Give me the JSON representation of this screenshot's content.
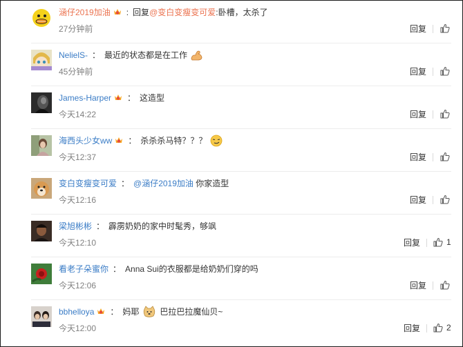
{
  "comments": [
    {
      "user": "涵仔2019加油",
      "user_color": "#eb7350",
      "vip": true,
      "reply_prefix": "回复",
      "mention": "@变白变瘦变可爱",
      "separator": ":",
      "text": "卧槽，太杀了",
      "emoji": "",
      "time": "27分钟前",
      "reply_label": "回复",
      "likes": "",
      "avatar": "duck"
    },
    {
      "user": "NelielS-",
      "user_color": "#3a7cc6",
      "vip": false,
      "reply_prefix": "",
      "mention": "",
      "separator": "：",
      "text": "最近的状态都是在工作",
      "emoji": "muscle-emoji",
      "time": "45分钟前",
      "reply_label": "回复",
      "likes": "",
      "avatar": "anime"
    },
    {
      "user": "James-Harper",
      "user_color": "#3a7cc6",
      "vip": true,
      "reply_prefix": "",
      "mention": "",
      "separator": "：",
      "text": "这造型",
      "emoji": "",
      "time": "今天14:22",
      "reply_label": "回复",
      "likes": "",
      "avatar": "dark"
    },
    {
      "user": "海西头少女ww",
      "user_color": "#3a7cc6",
      "vip": true,
      "reply_prefix": "",
      "mention": "",
      "separator": "：",
      "text": "杀杀杀马特？？？",
      "emoji": "smirk-emoji",
      "time": "今天12:37",
      "reply_label": "回复",
      "likes": "",
      "avatar": "girl"
    },
    {
      "user": "变白变瘦变可爱",
      "user_color": "#3a7cc6",
      "vip": false,
      "reply_prefix": "",
      "mention": "@涵仔2019加油",
      "separator": "：",
      "text": " 你家造型",
      "emoji": "",
      "time": "今天12:16",
      "reply_label": "回复",
      "likes": "",
      "avatar": "dog"
    },
    {
      "user": "梁旭彬彬",
      "user_color": "#3a7cc6",
      "vip": false,
      "reply_prefix": "",
      "mention": "",
      "separator": "：",
      "text": "霹雳奶奶的家中时髦秀，够飒",
      "emoji": "",
      "time": "今天12:10",
      "reply_label": "回复",
      "likes": "1",
      "avatar": "woman"
    },
    {
      "user": "看老子朵蜜你",
      "user_color": "#3a7cc6",
      "vip": false,
      "reply_prefix": "",
      "mention": "",
      "separator": "：",
      "text": "Anna Sui的衣服都是给奶奶们穿的吗",
      "emoji": "",
      "time": "今天12:06",
      "reply_label": "回复",
      "likes": "",
      "avatar": "flower"
    },
    {
      "user": "bbhelloya",
      "user_color": "#3a7cc6",
      "vip": true,
      "reply_prefix": "",
      "mention": "",
      "separator": "：",
      "text": "巴拉巴拉魔仙贝~",
      "text_before": "妈耶",
      "emoji": "doge-emoji",
      "time": "今天12:00",
      "reply_label": "回复",
      "likes": "2",
      "avatar": "couple"
    }
  ],
  "colors": {
    "link_orange": "#eb7350",
    "link_blue": "#3a7cc6",
    "text": "#333333",
    "time": "#808080"
  }
}
